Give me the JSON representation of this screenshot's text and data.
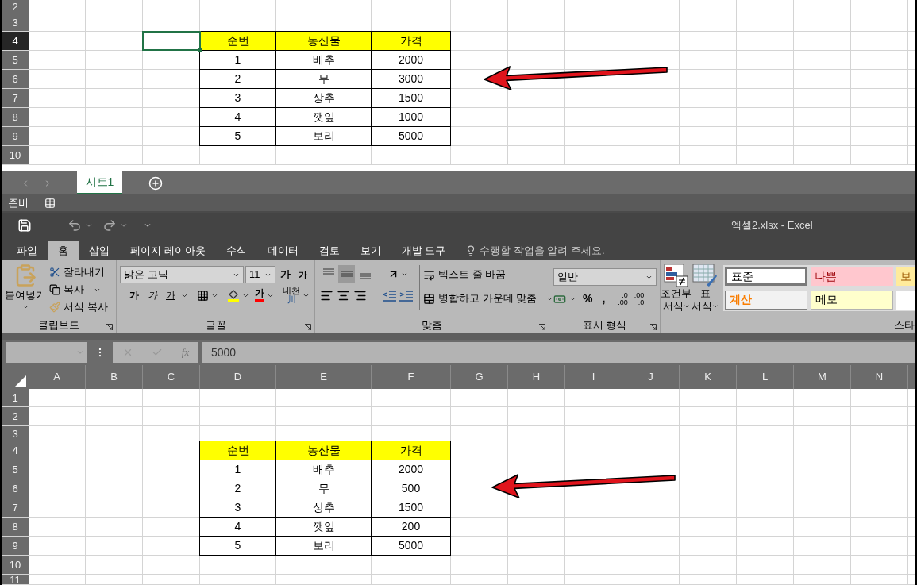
{
  "top_sheet": {
    "rows": [
      {
        "label": "2",
        "selected": false
      },
      {
        "label": "3",
        "selected": false
      },
      {
        "label": "4",
        "selected": true,
        "header": true,
        "cells": [
          "순번",
          "농산물",
          "가격"
        ]
      },
      {
        "label": "5",
        "selected": false,
        "cells": [
          "1",
          "배추",
          "2000"
        ]
      },
      {
        "label": "6",
        "selected": false,
        "cells": [
          "2",
          "무",
          "3000"
        ]
      },
      {
        "label": "7",
        "selected": false,
        "cells": [
          "3",
          "상추",
          "1500"
        ]
      },
      {
        "label": "8",
        "selected": false,
        "cells": [
          "4",
          "깻잎",
          "1000"
        ]
      },
      {
        "label": "9",
        "selected": false,
        "cells": [
          "5",
          "보리",
          "5000"
        ]
      },
      {
        "label": "10",
        "selected": false
      }
    ]
  },
  "sheet_tabs": [
    {
      "label": "시트1",
      "selected": true
    }
  ],
  "status_bar": {
    "text": "준비"
  },
  "window": {
    "title": "엑셀2.xlsx - Excel"
  },
  "ribbon_tabs": [
    {
      "label": "파일",
      "selected": false
    },
    {
      "label": "홈",
      "selected": true
    },
    {
      "label": "삽입",
      "selected": false
    },
    {
      "label": "페이지 레이아웃",
      "selected": false
    },
    {
      "label": "수식",
      "selected": false
    },
    {
      "label": "데이터",
      "selected": false
    },
    {
      "label": "검토",
      "selected": false
    },
    {
      "label": "보기",
      "selected": false
    },
    {
      "label": "개발 도구",
      "selected": false
    }
  ],
  "tell_me": {
    "placeholder": "수행할 작업을 알려 주세요."
  },
  "ribbon": {
    "clipboard": {
      "label": "클립보드",
      "paste": "붙여넣기",
      "cut": "잘라내기",
      "copy": "복사",
      "format_painter": "서식 복사"
    },
    "font": {
      "label": "글꼴",
      "name": "맑은 고딕",
      "size": "11",
      "grow": "가",
      "shrink": "가",
      "bold": "가",
      "italic": "가",
      "underline": "가",
      "font_color_glyph": "가",
      "phonetic": "내천",
      "phonetic_sub": "川"
    },
    "alignment": {
      "label": "맞춤",
      "vertical": [
        {
          "selected": false
        },
        {
          "selected": true
        },
        {
          "selected": false
        }
      ],
      "wrap_text": "텍스트 줄 바꿈",
      "merge": "병합하고 가운데 맞춤"
    },
    "number": {
      "label": "표시 형식",
      "format": "일반",
      "percent": "%",
      "comma": ",",
      "decimals": [
        {
          "top": ".0",
          "bottom": ".00"
        },
        {
          "top": ".00",
          "bottom": ".0"
        }
      ]
    },
    "styles": {
      "label": "스타",
      "conditional": [
        "조건부",
        "서식"
      ],
      "table": [
        "표",
        "서식"
      ],
      "items": [
        {
          "label": "표준",
          "kind": "normal"
        },
        {
          "label": "나쁨",
          "kind": "bad"
        },
        {
          "label": "보",
          "kind": "neutral"
        },
        {
          "label": "계산",
          "kind": "calculation"
        },
        {
          "label": "메모",
          "kind": "note"
        },
        {
          "kind": "explanatory"
        }
      ]
    }
  },
  "formula_bar": {
    "fx": "fx",
    "value": "5000"
  },
  "sheet": {
    "columns": [
      "A",
      "B",
      "C",
      "D",
      "E",
      "F",
      "G",
      "H",
      "I",
      "J",
      "K",
      "L",
      "M",
      "N"
    ],
    "rows": [
      {
        "label": "1",
        "selected": false
      },
      {
        "label": "2",
        "selected": false
      },
      {
        "label": "3",
        "selected": false
      },
      {
        "label": "4",
        "selected": false,
        "header": true,
        "cells": [
          "순번",
          "농산물",
          "가격"
        ]
      },
      {
        "label": "5",
        "selected": false,
        "cells": [
          "1",
          "배추",
          "2000"
        ]
      },
      {
        "label": "6",
        "selected": false,
        "cells": [
          "2",
          "무",
          "500"
        ]
      },
      {
        "label": "7",
        "selected": false,
        "cells": [
          "3",
          "상추",
          "1500"
        ]
      },
      {
        "label": "8",
        "selected": false,
        "cells": [
          "4",
          "깻잎",
          "200"
        ]
      },
      {
        "label": "9",
        "selected": false,
        "cells": [
          "5",
          "보리",
          "5000"
        ]
      },
      {
        "label": "10",
        "selected": false
      },
      {
        "label": "11",
        "selected": false
      }
    ]
  }
}
